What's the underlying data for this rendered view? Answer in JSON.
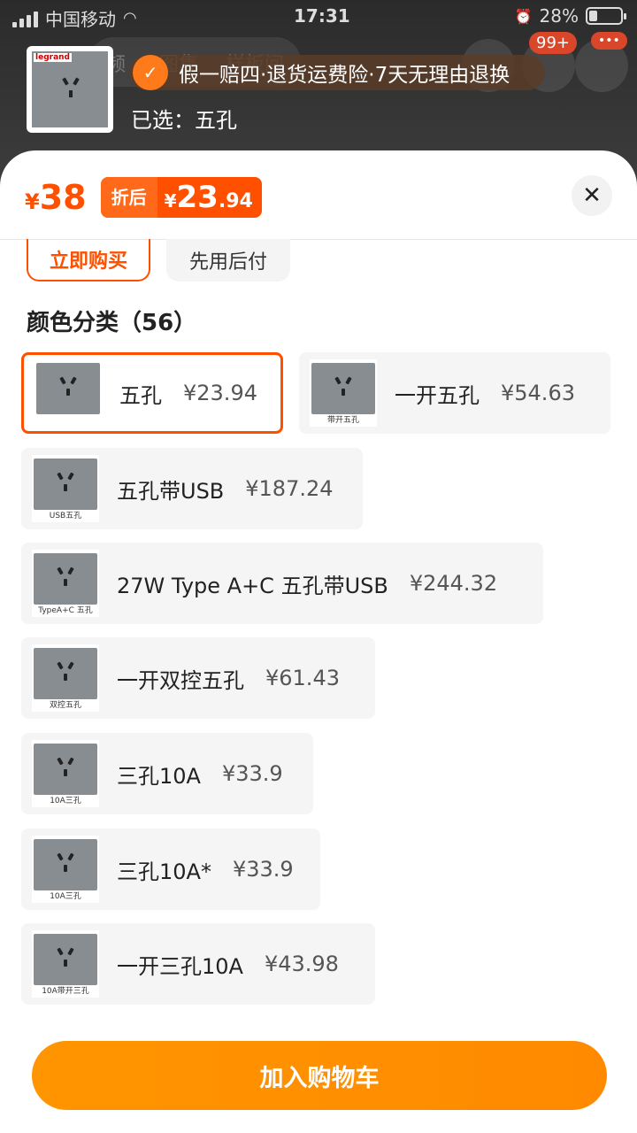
{
  "status_bar": {
    "carrier": "中国移动",
    "time": "17:31",
    "battery": "28%"
  },
  "background": {
    "tab_1": "频",
    "tab_2": "图集",
    "tab_3": "样板间",
    "cart_badge": "99+",
    "more_badge": "•••"
  },
  "header": {
    "brand_logo_text": "legrand",
    "guarantee_text": "假一赔四·退货运费险·7天无理由退换",
    "selected_label": "已选：五孔"
  },
  "price": {
    "currency": "¥",
    "original": "38",
    "discount_label": "折后",
    "discount_int": "23",
    "discount_dec": ".94"
  },
  "pay_options": {
    "buy_now": "立即购买",
    "pay_later": "先用后付"
  },
  "section": {
    "title": "颜色分类（56）"
  },
  "options": [
    {
      "name": "五孔",
      "price": "¥23.94",
      "caption": "",
      "selected": true
    },
    {
      "name": "一开五孔",
      "price": "¥54.63",
      "caption": "带开五孔",
      "selected": false
    },
    {
      "name": "五孔带USB",
      "price": "¥187.24",
      "caption": "USB五孔",
      "selected": false
    },
    {
      "name": "27W Type A+C 五孔带USB",
      "price": "¥244.32",
      "caption": "TypeA+C 五孔",
      "selected": false
    },
    {
      "name": "一开双控五孔",
      "price": "¥61.43",
      "caption": "双控五孔",
      "selected": false
    },
    {
      "name": "三孔10A",
      "price": "¥33.9",
      "caption": "10A三孔",
      "selected": false
    },
    {
      "name": "三孔10A*",
      "price": "¥33.9",
      "caption": "10A三孔",
      "selected": false
    },
    {
      "name": "一开三孔10A",
      "price": "¥43.98",
      "caption": "10A带开三孔",
      "selected": false
    }
  ],
  "footer": {
    "add_to_cart": "加入购物车"
  },
  "colors": {
    "accent": "#ff5000",
    "cart_button": "#ff9500"
  }
}
